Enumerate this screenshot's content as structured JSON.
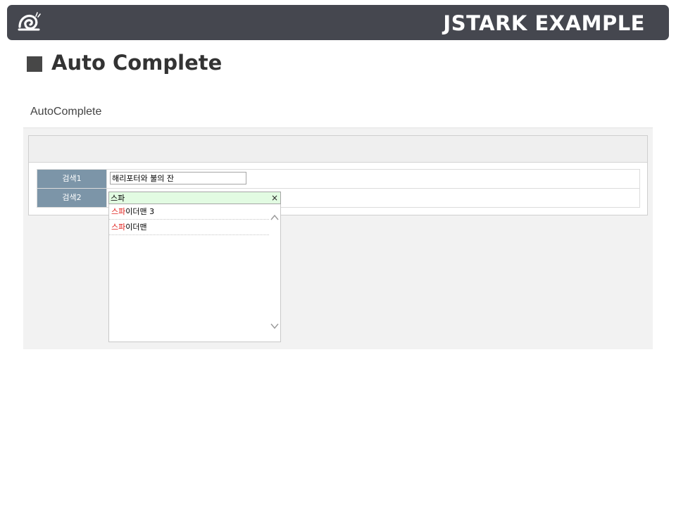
{
  "header": {
    "brand": "JSTARK EXAMPLE",
    "logo_icon": "snail-icon"
  },
  "page": {
    "title": "Auto Complete",
    "section_label": "AutoComplete"
  },
  "form": {
    "rows": [
      {
        "label": "검색1",
        "value": "해리포터와 불의 잔"
      },
      {
        "label": "검색2",
        "value": "스파",
        "clear_label": "×"
      }
    ]
  },
  "autocomplete": {
    "query": "스파",
    "items": [
      {
        "match": "스파",
        "rest": "이더맨 3"
      },
      {
        "match": "스파",
        "rest": "이더맨"
      }
    ]
  },
  "colors": {
    "header_bg": "#45474f",
    "label_bg": "#7c95a8",
    "highlight": "#e0201c",
    "active_input_bg": "#e2fbe2"
  }
}
